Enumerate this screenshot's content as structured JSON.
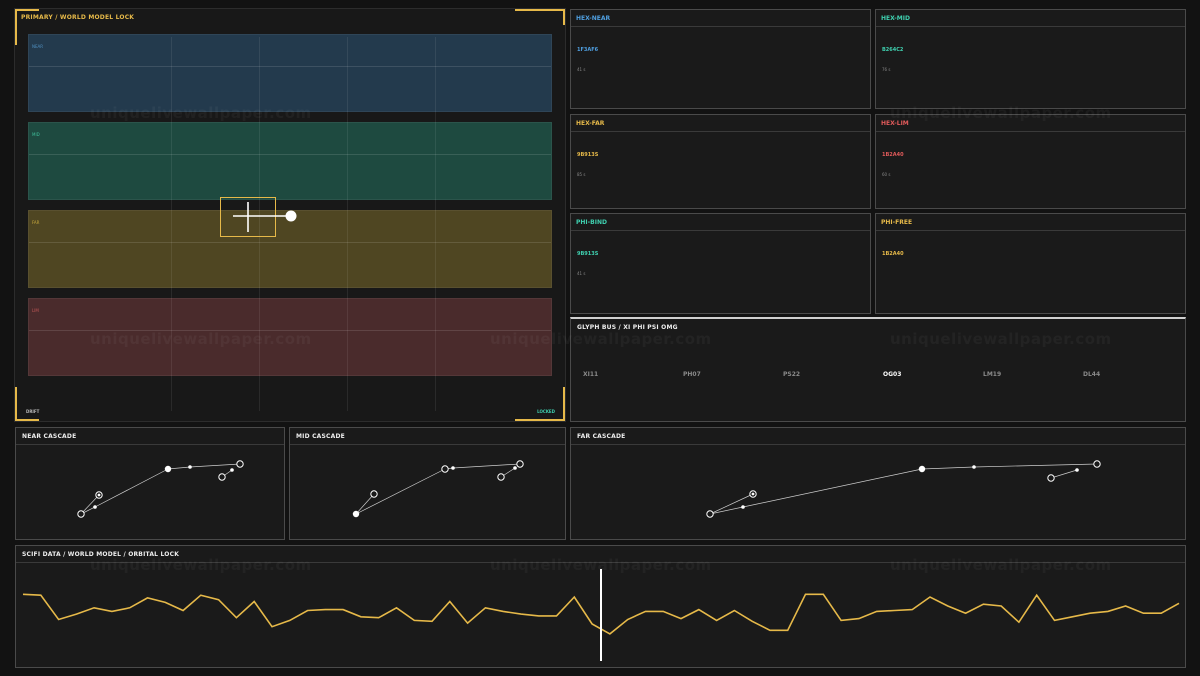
{
  "primary": {
    "title_main": "PRIMARY",
    "title_sep": " / ",
    "title_sub": "WORLD MODEL LOCK",
    "bands": [
      {
        "label": "NEAR",
        "color": "#233a4d",
        "label_color": "#4f8fc0"
      },
      {
        "label": "MID",
        "color": "#1e4a40",
        "label_color": "#3fbf9a"
      },
      {
        "label": "FAR",
        "color": "#4f4622",
        "label_color": "#c9a93c"
      },
      {
        "label": "LIM",
        "color": "#4a2b2c",
        "label_color": "#c05656"
      }
    ],
    "footer_left": "DRIFT",
    "footer_right": "LOCKED",
    "accent": "#e6b949"
  },
  "cards": [
    {
      "title": "HEX-NEAR",
      "value": "1F3AF6",
      "sub": "41 s",
      "color": "#4f9fe0"
    },
    {
      "title": "HEX-MID",
      "value": "B264C2",
      "sub": "76 s",
      "color": "#3fd1b0"
    },
    {
      "title": "HEX-FAR",
      "value": "9B913S",
      "sub": "85 s",
      "color": "#e6b949"
    },
    {
      "title": "HEX-LIM",
      "value": "1B2A40",
      "sub": "60 s",
      "color": "#e05a5a"
    },
    {
      "title": "PHI-BIND",
      "value": "9B913S",
      "sub": "41 s",
      "color": "#3fd1b0"
    },
    {
      "title": "PHI-FREE",
      "value": "1B2A40",
      "sub": "",
      "color": "#e6b949"
    }
  ],
  "glyph_bus": {
    "title": "GLYPH BUS",
    "sep": " / ",
    "subtitle": "XI PHI PSI OMG",
    "items": [
      {
        "label": "XI11",
        "active": false
      },
      {
        "label": "PH07",
        "active": false
      },
      {
        "label": "PS22",
        "active": false
      },
      {
        "label": "OG03",
        "active": true
      },
      {
        "label": "LM19",
        "active": false
      },
      {
        "label": "DL44",
        "active": false
      }
    ]
  },
  "cascades": [
    {
      "title": "NEAR CASCADE"
    },
    {
      "title": "MID CASCADE"
    },
    {
      "title": "FAR CASCADE"
    }
  ],
  "scifi": {
    "title": "SCIFI DATA",
    "sep": " / ",
    "sub1": "WORLD MODEL",
    "sub2": "ORBITAL LOCK",
    "line_color": "#e6b949",
    "series": [
      0.27,
      0.28,
      0.55,
      0.49,
      0.42,
      0.46,
      0.42,
      0.31,
      0.36,
      0.45,
      0.28,
      0.33,
      0.53,
      0.35,
      0.63,
      0.56,
      0.45,
      0.44,
      0.44,
      0.52,
      0.53,
      0.42,
      0.56,
      0.57,
      0.35,
      0.59,
      0.42,
      0.46,
      0.49,
      0.51,
      0.51,
      0.3,
      0.6,
      0.71,
      0.55,
      0.46,
      0.46,
      0.54,
      0.44,
      0.56,
      0.45,
      0.57,
      0.67,
      0.67,
      0.27,
      0.27,
      0.56,
      0.54,
      0.46,
      0.45,
      0.44,
      0.3,
      0.4,
      0.48,
      0.38,
      0.4,
      0.58,
      0.28,
      0.56,
      0.52,
      0.48,
      0.46,
      0.4,
      0.48,
      0.48,
      0.37
    ]
  },
  "watermark": "uniquelivewallpaper.com"
}
